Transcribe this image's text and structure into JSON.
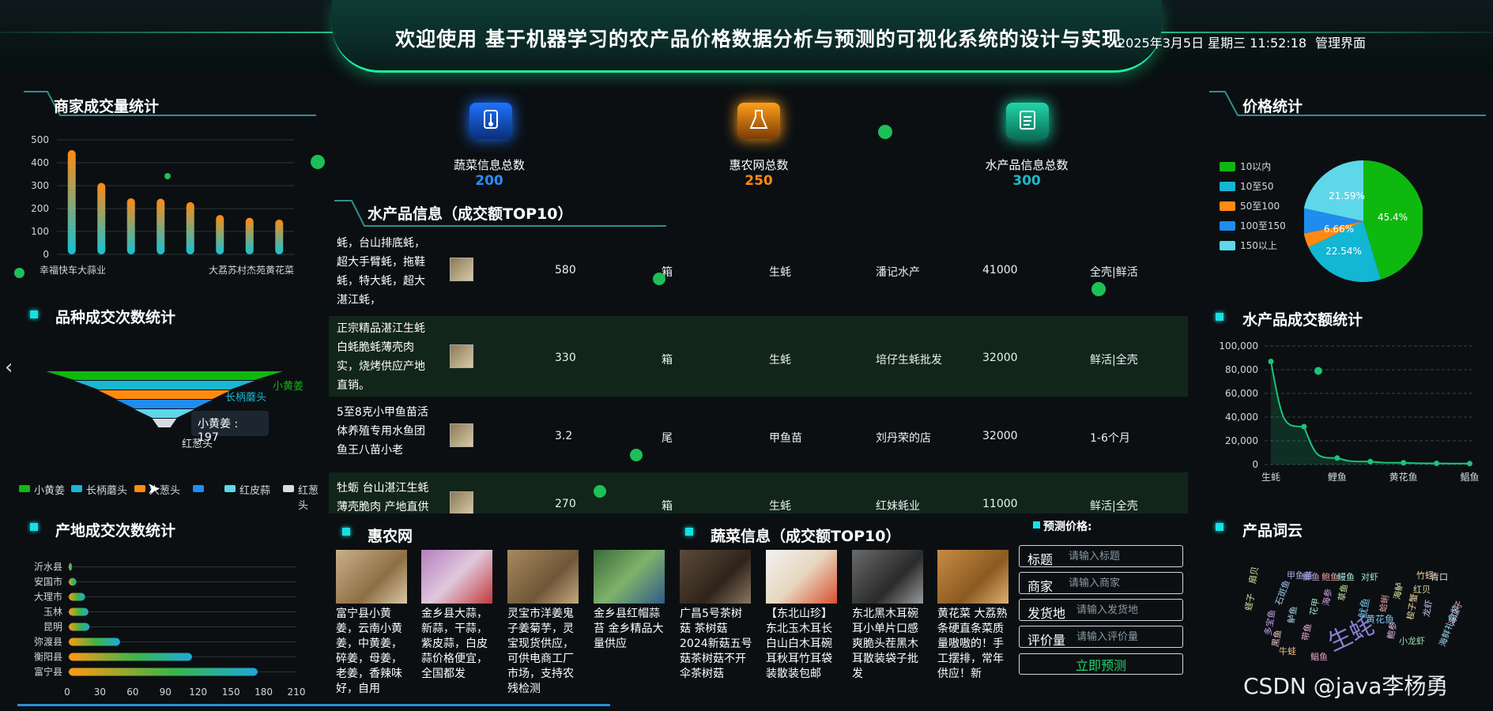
{
  "header": {
    "title": "欢迎使用 基于机器学习的农产品价格数据分析与预测的可视化系统的设计与实现",
    "datetime": "2025年3月5日 星期三 11:52:18",
    "admin_link": "管理界面"
  },
  "merchant_panel": {
    "title": "商家成交量统计",
    "chart_data": {
      "type": "bar",
      "categories": [
        "幸福快车大蒜业",
        "",
        "",
        "",
        "",
        "",
        "大荔苏村杰苑黄花菜",
        ""
      ],
      "values": [
        455,
        312,
        245,
        243,
        228,
        172,
        160,
        152
      ],
      "ylim": [
        0,
        500
      ],
      "yticks": [
        0,
        100,
        200,
        300,
        400,
        500
      ],
      "colors": [
        "#ff8a12",
        "#13c2d6"
      ]
    }
  },
  "variety_panel": {
    "title": "品种成交次数统计",
    "tooltip": "小黄姜 : 197",
    "chart_data": {
      "type": "funnel",
      "categories": [
        "小黄姜",
        "长柄蘑头",
        "大葱头",
        "红皮蒜",
        "红皮蒜",
        "红葱头"
      ],
      "values": [
        197,
        150,
        110,
        80,
        50,
        20
      ],
      "labels_shown": [
        "小黄姜",
        "长柄蘑头",
        "红葱头"
      ],
      "colors": [
        "#0fb80f",
        "#17b7d6",
        "#ff8a12",
        "#1f8cf0",
        "#5ed7e8",
        "#d6dde2"
      ]
    },
    "legend": [
      {
        "label": "小黄姜",
        "color": "#0fb80f"
      },
      {
        "label": "长柄蘑头",
        "color": "#17b7d6"
      },
      {
        "label": "大葱头",
        "color": "#ff8a12"
      },
      {
        "label": "",
        "color": "#1f8cf0"
      },
      {
        "label": "红皮蒜",
        "color": "#5ed7e8"
      },
      {
        "label": "红葱头",
        "color": "#d6dde2"
      }
    ]
  },
  "origin_panel": {
    "title": "产地成交次数统计",
    "chart_data": {
      "type": "bar",
      "orientation": "horizontal",
      "categories": [
        "沂水县",
        "安国市",
        "大理市",
        "玉林",
        "昆明",
        "弥渡县",
        "衡阳县",
        "富宁县"
      ],
      "values": [
        3,
        7,
        15,
        18,
        19,
        47,
        113,
        173
      ],
      "xlim": [
        0,
        210
      ],
      "xticks": [
        0,
        30,
        60,
        90,
        120,
        150,
        180,
        210
      ]
    }
  },
  "stats": [
    {
      "label": "蔬菜信息总数",
      "value": "200",
      "color": "#2b8cff",
      "icon": "thermometer-icon"
    },
    {
      "label": "惠农网总数",
      "value": "250",
      "color": "#ff8a12",
      "icon": "flask-icon"
    },
    {
      "label": "水产品信息总数",
      "value": "300",
      "color": "#1fb8c8",
      "icon": "clipboard-icon"
    }
  ],
  "aquatic_table": {
    "title": "水产品信息（成交额TOP10）",
    "rows": [
      {
        "name": "蚝，台山排底蚝，超大手臂蚝，拖鞋蚝，特大蚝，超大湛江蚝，",
        "price": "580",
        "unit": "箱",
        "category": "生蚝",
        "shop": "潘记水产",
        "amount": "41000",
        "tag": "全壳|鲜活"
      },
      {
        "name": "正宗精品湛江生蚝白蚝脆蚝薄壳肉实，烧烤供应产地直销。",
        "price": "330",
        "unit": "箱",
        "category": "生蚝",
        "shop": "培仔生蚝批发",
        "amount": "32000",
        "tag": "鲜活|全壳"
      },
      {
        "name": "5至8克小甲鱼苗活体养殖专用水鱼团鱼王八苗小老",
        "price": "3.2",
        "unit": "尾",
        "category": "甲鱼苗",
        "shop": "刘丹荣的店",
        "amount": "32000",
        "tag": "1-6个月"
      },
      {
        "name": "牡蛎 台山湛江生蚝薄壳脆肉 产地直供",
        "price": "270",
        "unit": "箱",
        "category": "生蚝",
        "shop": "红妹蚝业",
        "amount": "11000",
        "tag": "鲜活|全壳"
      }
    ]
  },
  "huinong": {
    "title": "惠农网",
    "cards": [
      {
        "text": "富宁县小黄姜，云南小黄姜，中黄姜，碎姜，母姜，老姜，香辣味好，自用"
      },
      {
        "text": "金乡县大蒜，新蒜，干蒜，紫皮蒜，白皮蒜价格便宜，全国都发"
      },
      {
        "text": "灵宝市洋姜鬼子姜菊芋，灵宝现货供应，可供电商工厂市场，支持农残检测"
      },
      {
        "text": "金乡县红帽蒜苔 金乡精品大量供应"
      }
    ]
  },
  "vegetable": {
    "title": "蔬菜信息（成交额TOP10）",
    "cards": [
      {
        "text": "广昌5号茶树菇 茶树菇2024新菇五号菇茶树菇不开伞茶树菇"
      },
      {
        "text": "【东北山珍】东北玉木耳长白山白木耳碗耳秋耳竹耳袋装散装包邮"
      },
      {
        "text": "东北黑木耳碗耳小单片口感爽脆头茬黑木耳散装袋子批发"
      },
      {
        "text": "黄花菜 大荔熟条硬直条菜质量嗷嗷的！手工摆排，常年供应！新"
      }
    ]
  },
  "predict": {
    "title": "预测价格:",
    "fields": [
      {
        "label": "标题",
        "placeholder": "请输入标题"
      },
      {
        "label": "商家",
        "placeholder": "请输入商家"
      },
      {
        "label": "发货地",
        "placeholder": "请输入发货地"
      },
      {
        "label": "评价量",
        "placeholder": "请输入评价量"
      }
    ],
    "button": "立即预测"
  },
  "price_panel": {
    "title": "价格统计",
    "chart_data": {
      "type": "pie",
      "categories": [
        "10以内",
        "10至50",
        "50至100",
        "100至150",
        "150以上"
      ],
      "values": [
        45.4,
        22.54,
        3.81,
        6.66,
        21.59
      ],
      "labels_shown": [
        "45.4%",
        "22.54%",
        "6.66%",
        "21.59%"
      ],
      "colors": [
        "#0fb80f",
        "#13b6d3",
        "#ff8a12",
        "#1f8cf0",
        "#5ed7e8"
      ]
    }
  },
  "aquatic_amount": {
    "title": "水产品成交额统计",
    "chart_data": {
      "type": "line",
      "categories": [
        "生蚝",
        "",
        "鲤鱼",
        "",
        "黄花鱼",
        "",
        "鲳鱼"
      ],
      "values": [
        87000,
        32000,
        5500,
        2500,
        1500,
        1000,
        800
      ],
      "outlier": {
        "category_index": 1,
        "value": 79000
      },
      "ylim": [
        0,
        100000
      ],
      "yticks": [
        "0",
        "20,000",
        "40,000",
        "60,000",
        "80,000",
        "100,000"
      ],
      "color": "#1cc47a"
    }
  },
  "wordcloud": {
    "title": "产品词云",
    "words": [
      "生蚝",
      "鲳鱼",
      "黄花鱼",
      "鲫鱼",
      "红贝",
      "青口",
      "海瓜子",
      "海鲜礼盒装",
      "蛏子",
      "小龙虾",
      "竹蛏",
      "石斑鱼",
      "鱿鱼",
      "带鱼",
      "鲈鱼",
      "牛蛙",
      "多宝鱼",
      "海鲈",
      "蛤蜊",
      "鳗鱼",
      "鲍鱼",
      "扇贝",
      "对虾",
      "草鱼",
      "梭子蟹",
      "甲鱼苗",
      "海参",
      "花甲",
      "鲍参",
      "龙虾",
      "黑鱼"
    ]
  },
  "watermark": "CSDN @java李杨勇"
}
